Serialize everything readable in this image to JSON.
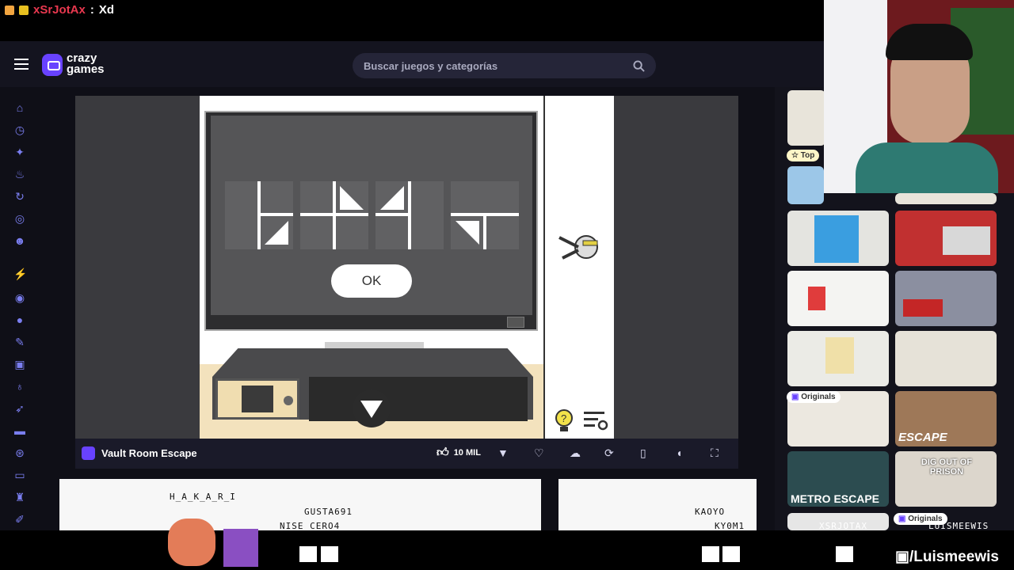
{
  "chat": {
    "username": "xSrJotAx",
    "separator": ":",
    "message": "Xd"
  },
  "header": {
    "logo_line1": "crazy",
    "logo_line2": "games",
    "search_placeholder": "Buscar juegos y categorías"
  },
  "sidebar": {
    "icons": [
      "home-icon",
      "clock-icon",
      "sparkle-icon",
      "fire-icon",
      "refresh-icon",
      "controller-icon",
      "users-icon",
      "bolt-icon",
      "compass-icon",
      "ball-icon",
      "wrench-icon",
      "dice-icon",
      "bomb-icon",
      "car-icon",
      "wheel-icon",
      "gamepad-icon",
      "chess-icon",
      "pencil-icon"
    ]
  },
  "game": {
    "title": "Vault Room Escape",
    "ok_label": "OK",
    "likes": "10 MIL"
  },
  "right": {
    "top_badge": "Top",
    "originals_1": "Originals",
    "originals_2": "Originals",
    "escape_label": "ESCAPE",
    "dig_out_label": "DIG OUT OF PRISON",
    "metro_label": "METRO ESCAPE"
  },
  "stream": {
    "names": [
      "H_A_K_A_R_I",
      "GUSTA691",
      "NISE_CERO4",
      "KAOYO",
      "KY0M1",
      "XSRJOTAX",
      "LUISMEEWIS"
    ],
    "twitch_handle": "/Luismeewis"
  },
  "colors": {
    "brand": "#6842ff",
    "chat_name": "#e8384f"
  }
}
